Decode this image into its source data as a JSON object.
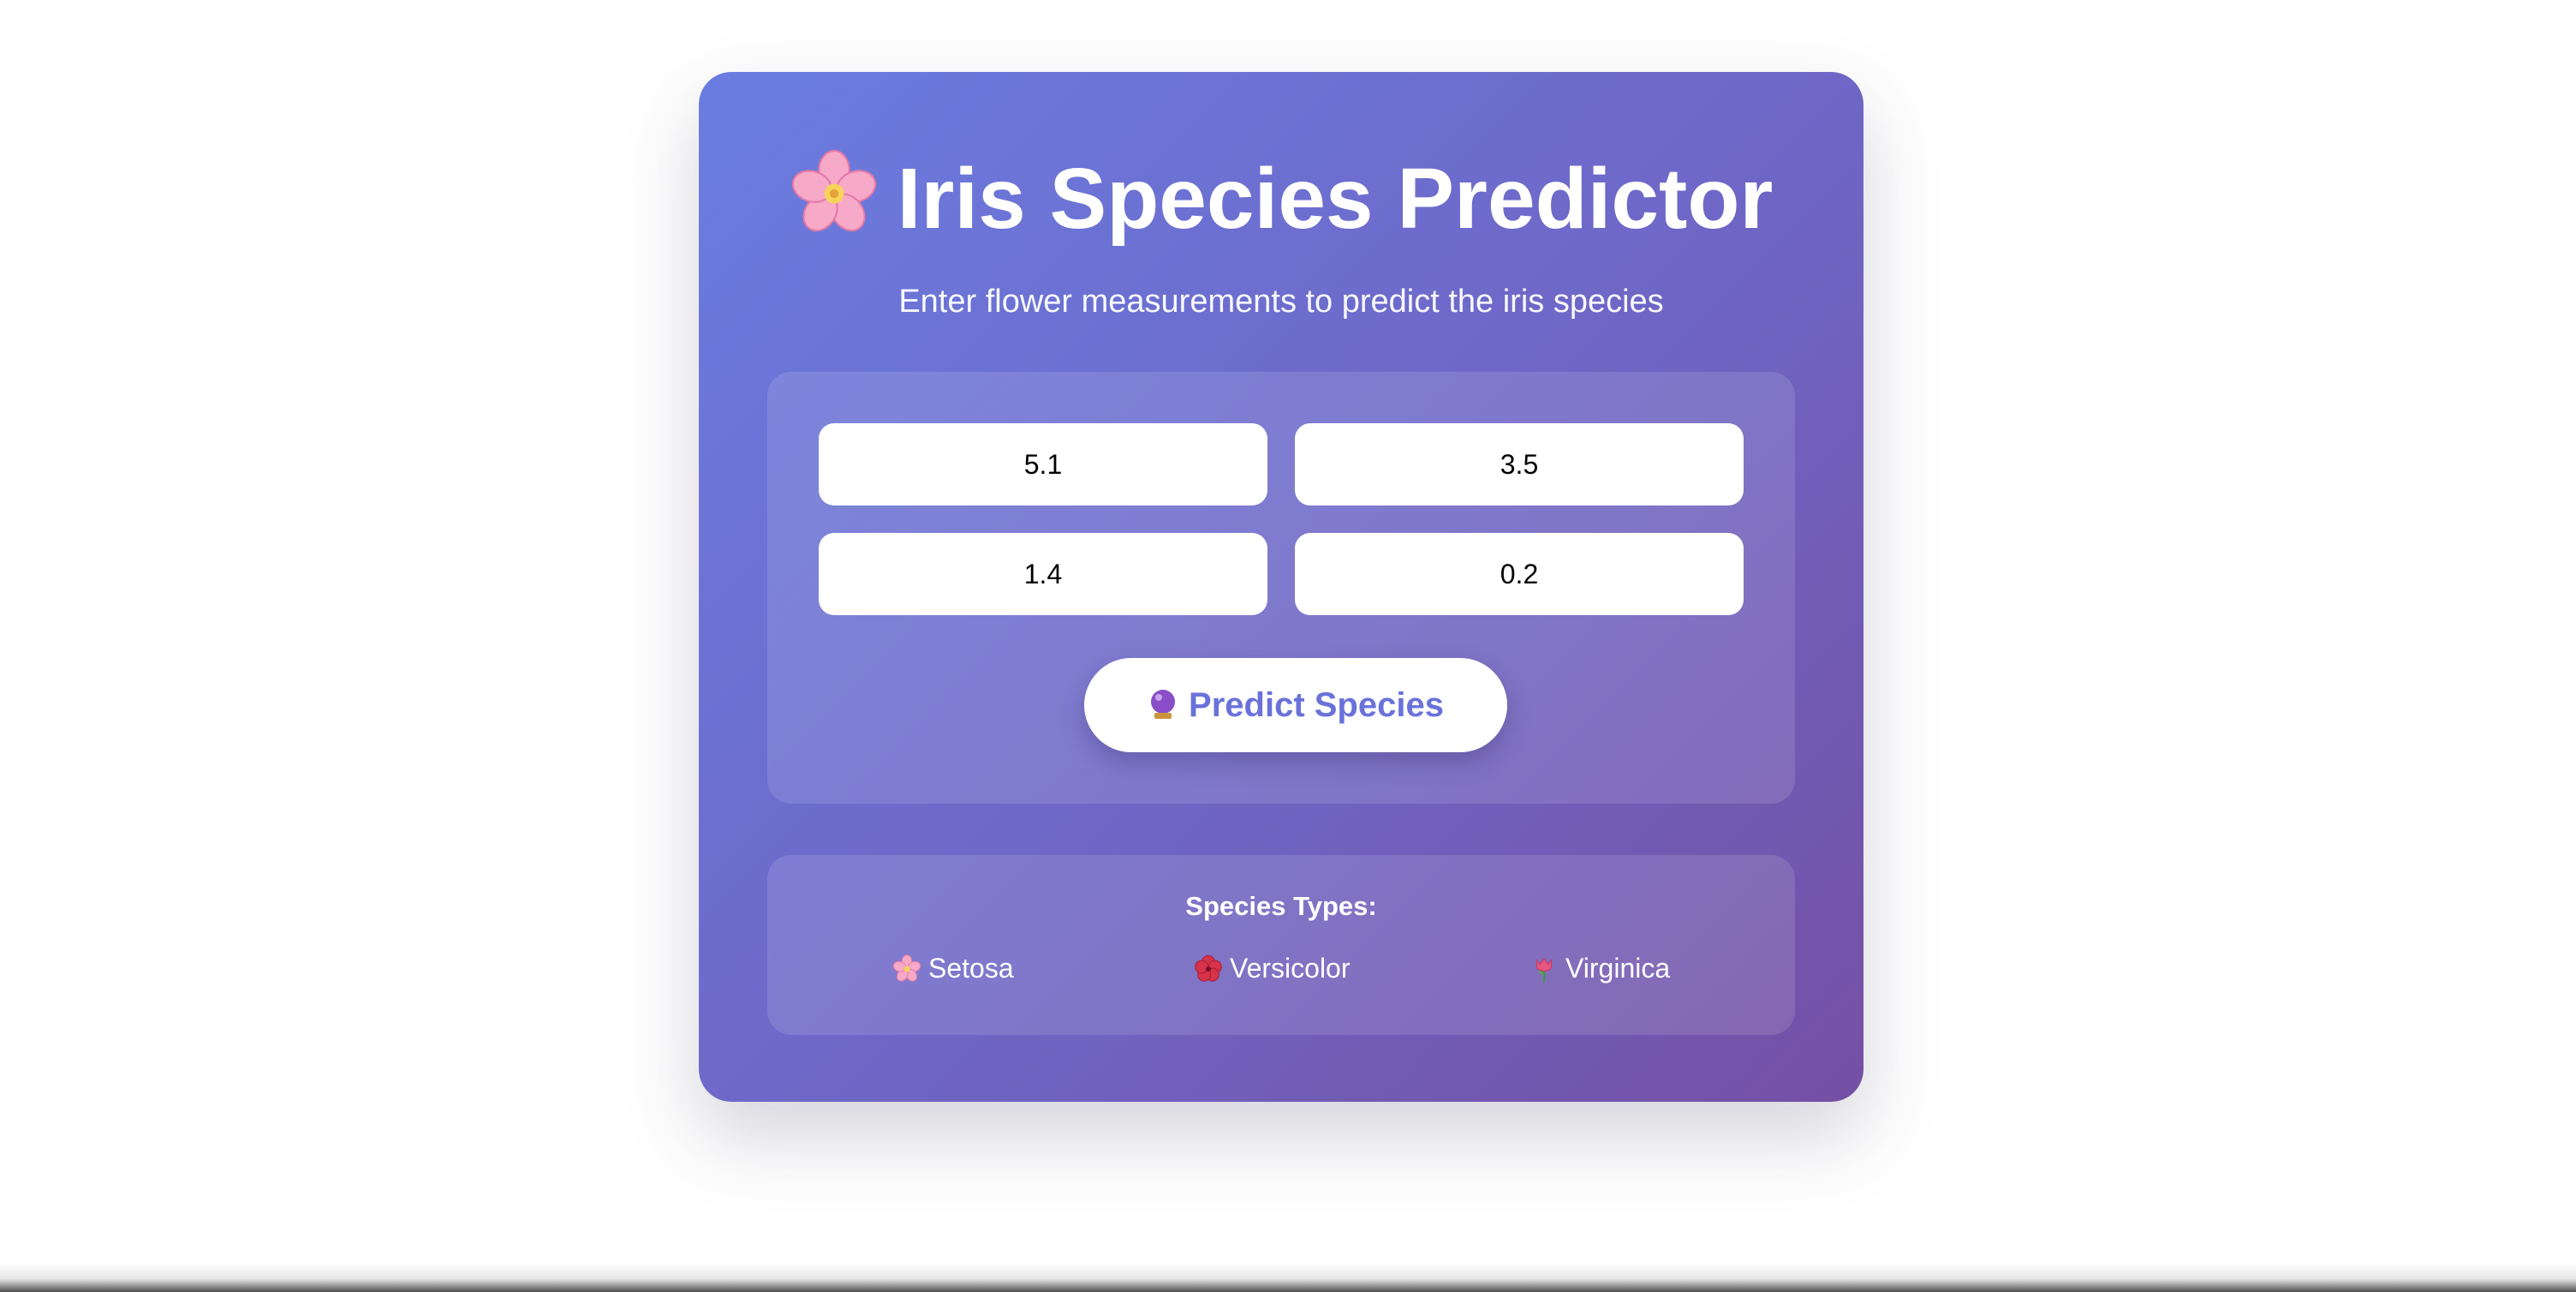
{
  "header": {
    "icon": "cherry-blossom-icon",
    "title": "Iris Species Predictor",
    "subtitle": "Enter flower measurements to predict the iris species"
  },
  "form": {
    "fields": [
      {
        "value": "5.1"
      },
      {
        "value": "3.5"
      },
      {
        "value": "1.4"
      },
      {
        "value": "0.2"
      }
    ],
    "predict_button": {
      "icon": "crystal-ball-icon",
      "label": "Predict Species"
    }
  },
  "species": {
    "heading": "Species Types:",
    "items": [
      {
        "icon": "cherry-blossom-icon",
        "label": "Setosa"
      },
      {
        "icon": "hibiscus-icon",
        "label": "Versicolor"
      },
      {
        "icon": "tulip-icon",
        "label": "Virginica"
      }
    ]
  },
  "colors": {
    "gradient_start": "#6a7de0",
    "gradient_end": "#7450a4",
    "button_text": "#6a72da",
    "text_light": "#ffffff"
  }
}
